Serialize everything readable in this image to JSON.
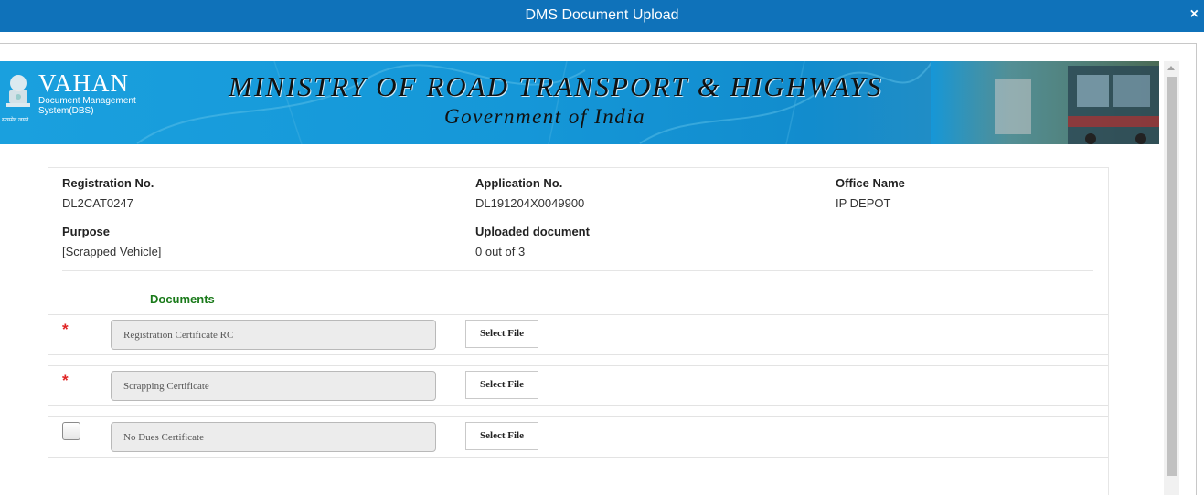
{
  "window": {
    "title": "DMS Document Upload",
    "close_label": "×"
  },
  "banner": {
    "brand_name": "VAHAN",
    "brand_line1": "Document Management",
    "brand_line2": "System(DBS)",
    "motto": "सत्यमेव जयते",
    "ministry": "MINISTRY OF ROAD TRANSPORT & HIGHWAYS",
    "government": "Government of India"
  },
  "info": {
    "registration_label": "Registration No.",
    "registration_value": "DL2CAT0247",
    "application_label": "Application No.",
    "application_value": "DL191204X0049900",
    "office_label": "Office Name",
    "office_value": "IP DEPOT",
    "purpose_label": "Purpose",
    "purpose_value": "[Scrapped Vehicle]",
    "uploaded_label": "Uploaded document",
    "uploaded_value": "0 out of 3"
  },
  "documents": {
    "heading": "Documents",
    "items": [
      {
        "name": "Registration Certificate RC",
        "required": true,
        "required_mark": "*",
        "button": "Select File"
      },
      {
        "name": "Scrapping Certificate",
        "required": true,
        "required_mark": "*",
        "button": "Select File"
      },
      {
        "name": "No Dues Certificate",
        "required": false,
        "checked": false,
        "button": "Select File"
      }
    ]
  },
  "colors": {
    "titlebar": "#0f72ba",
    "banner": "#1597d8",
    "required": "#e02424",
    "heading": "#1a7a1a"
  }
}
